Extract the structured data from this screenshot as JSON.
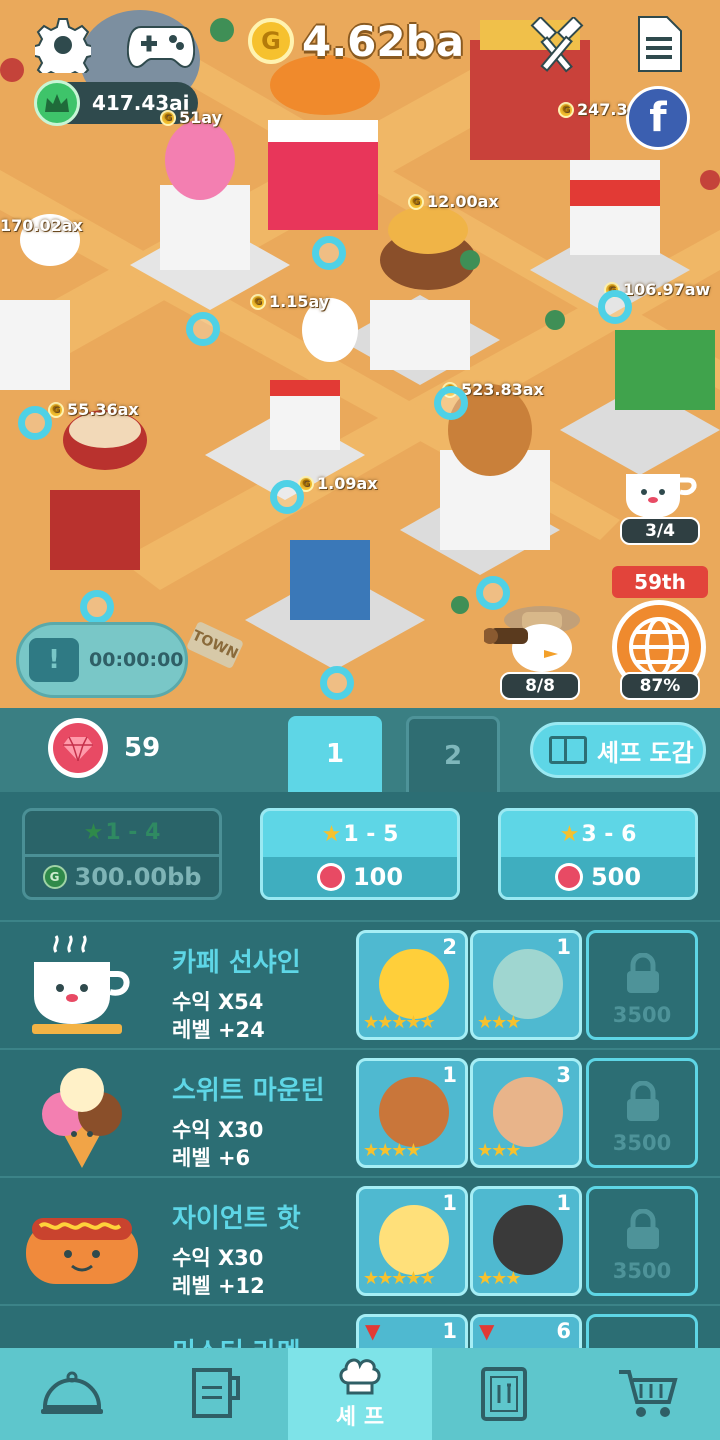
{
  "hud": {
    "coins": "4.62ba",
    "crown_value": "417.43ai",
    "ad_timer": "00:00:00",
    "coffee_counter": "3/4",
    "explorer_counter": "8/8",
    "rank": "59th",
    "globe_percent": "87%"
  },
  "map_labels": [
    {
      "text": "51ay"
    },
    {
      "text": "170.02ax"
    },
    {
      "text": "12.00ax"
    },
    {
      "text": "1.15ay"
    },
    {
      "text": "106.97aw"
    },
    {
      "text": "247.3"
    },
    {
      "text": "55.36ax"
    },
    {
      "text": "523.83ax"
    },
    {
      "text": "1.09ax"
    }
  ],
  "street_signs": {
    "town": "TOWN"
  },
  "tabbar": {
    "gems": "59",
    "tab1": "1",
    "tab2": "2",
    "chef_book": "셰프 도감"
  },
  "recruit": [
    {
      "stars": "1 - 4",
      "cost": "300.00bb",
      "currency": "gold"
    },
    {
      "stars": "1 - 5",
      "cost": "100",
      "currency": "gem"
    },
    {
      "stars": "3 - 6",
      "cost": "500",
      "currency": "gem"
    }
  ],
  "restaurants": [
    {
      "name": "카페 선샤인",
      "income": "수익 X54",
      "level": "레벨 +24",
      "chefs": [
        {
          "count": "2",
          "stars": "★★★★★"
        },
        {
          "count": "1",
          "stars": "★★★"
        }
      ],
      "lock_cost": "3500"
    },
    {
      "name": "스위트 마운틴",
      "income": "수익 X30",
      "level": "레벨 +6",
      "chefs": [
        {
          "count": "1",
          "stars": "★★★★"
        },
        {
          "count": "3",
          "stars": "★★★"
        }
      ],
      "lock_cost": "3500"
    },
    {
      "name": "자이언트 핫",
      "income": "수익 X30",
      "level": "레벨 +12",
      "chefs": [
        {
          "count": "1",
          "stars": "★★★★★"
        },
        {
          "count": "1",
          "stars": "★★★"
        }
      ],
      "lock_cost": "3500"
    },
    {
      "name": "미스터 라멘",
      "income": "",
      "level": "",
      "chefs": [
        {
          "count": "1",
          "stars": ""
        },
        {
          "count": "6",
          "stars": ""
        }
      ],
      "lock_cost": ""
    }
  ],
  "bottom_nav": [
    {
      "icon": "cloche-icon",
      "label": ""
    },
    {
      "icon": "blender-icon",
      "label": ""
    },
    {
      "icon": "chef-hat-icon",
      "label": "셰 프"
    },
    {
      "icon": "menu-book-icon",
      "label": ""
    },
    {
      "icon": "cart-icon",
      "label": ""
    }
  ],
  "colors": {
    "accent": "#5ed6e6",
    "panel": "#2c6e74",
    "map": "#e9a85a",
    "gem": "#e84a64",
    "coin": "#f6c12e"
  }
}
